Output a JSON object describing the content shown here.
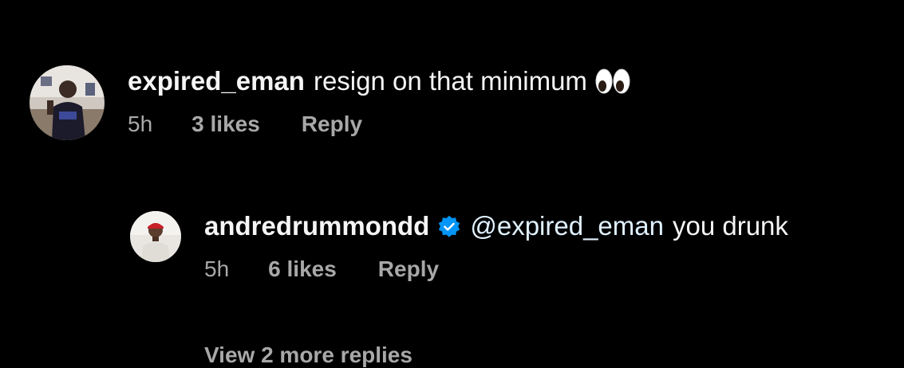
{
  "comments": [
    {
      "username": "expired_eman",
      "text": "resign on that minimum",
      "emoji_icon": "eyes-emoji",
      "time": "5h",
      "likes": "3 likes",
      "reply_label": "Reply"
    }
  ],
  "reply": {
    "username": "andredrummondd",
    "verified": true,
    "mention": "@expired_eman",
    "text": "you drunk",
    "time": "5h",
    "likes": "6 likes",
    "reply_label": "Reply"
  },
  "view_replies": {
    "label": "View 2 more replies"
  },
  "colors": {
    "background": "#000000",
    "primary_text": "#f5f5f5",
    "secondary_text": "#a8a8a8",
    "mention": "#e0f1ff",
    "verified_badge": "#0095f6"
  }
}
